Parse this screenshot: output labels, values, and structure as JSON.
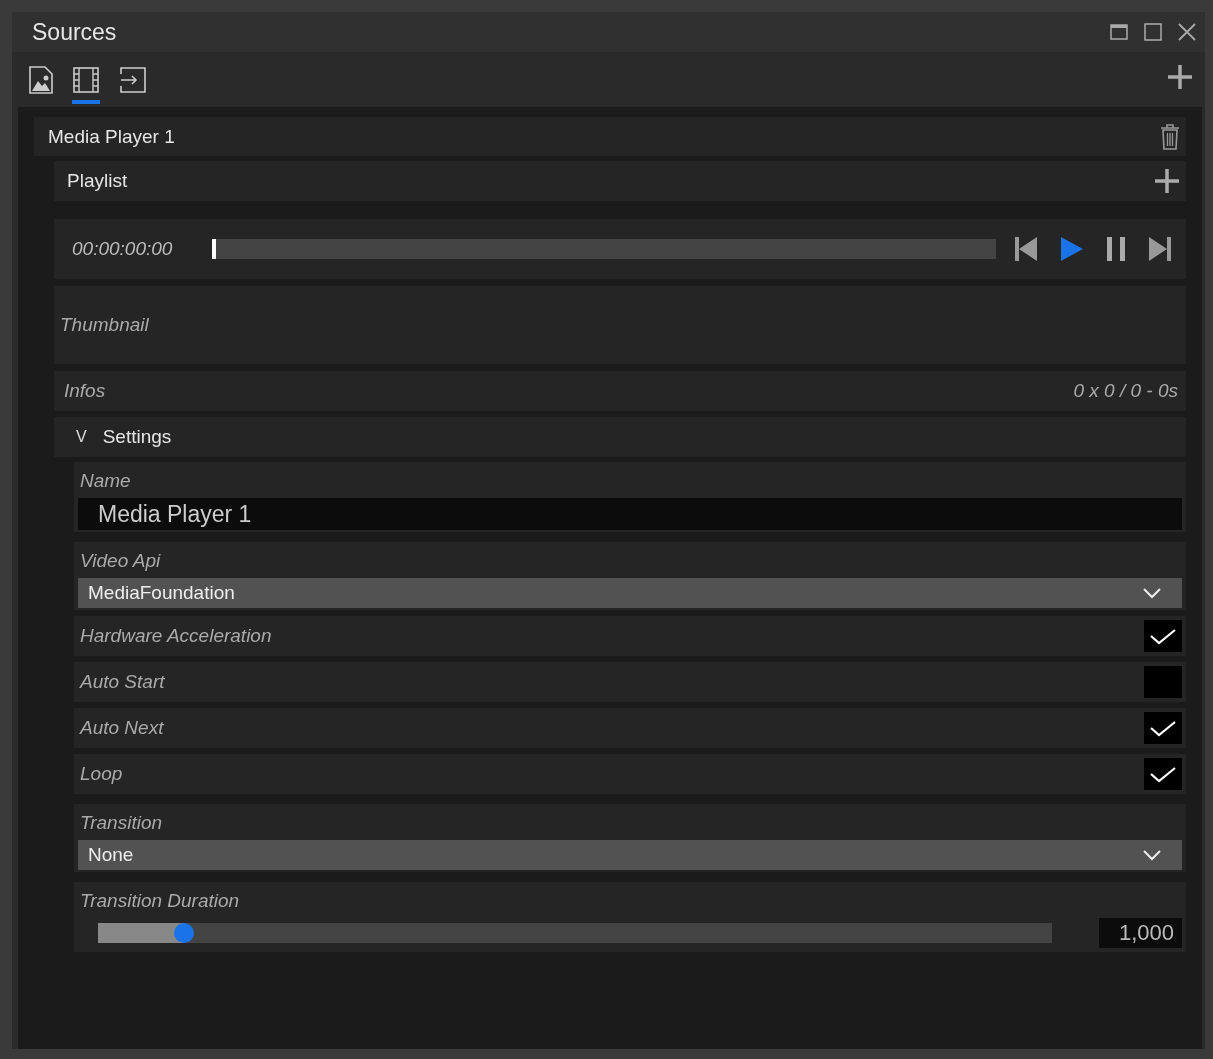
{
  "window": {
    "title": "Sources"
  },
  "tabs": [
    {
      "kind": "image",
      "selected": false
    },
    {
      "kind": "film",
      "selected": true
    },
    {
      "kind": "input",
      "selected": false
    }
  ],
  "source": {
    "name": "Media Player 1",
    "playlist": {
      "label": "Playlist"
    },
    "player": {
      "time": "00:00:00:00",
      "level": 0
    },
    "thumbnail": {
      "label": "Thumbnail"
    },
    "infos": {
      "label": "Infos",
      "value": "0 x 0 / 0 - 0s"
    },
    "settings": {
      "label": "Settings",
      "toggle": "V",
      "fields": [
        {
          "kind": "text",
          "label": "Name",
          "value": "Media Player 1"
        },
        {
          "kind": "dropdown",
          "label": "Video Api",
          "value": "MediaFoundation"
        },
        {
          "kind": "checkbox",
          "label": "Hardware Acceleration",
          "checked": true
        },
        {
          "kind": "checkbox",
          "label": "Auto Start",
          "checked": false
        },
        {
          "kind": "checkbox",
          "label": "Auto Next",
          "checked": true
        },
        {
          "kind": "checkbox",
          "label": "Loop",
          "checked": true
        },
        {
          "kind": "dropdown",
          "label": "Transition",
          "value": "None"
        },
        {
          "kind": "slider",
          "label": "Transition Duration",
          "level": 0.09,
          "value": "1,000"
        }
      ]
    }
  }
}
